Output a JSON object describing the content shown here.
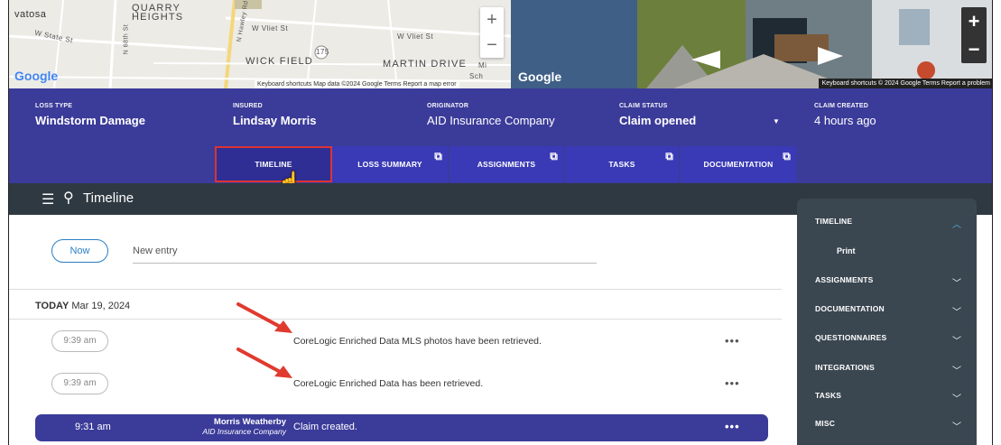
{
  "map": {
    "labels": [
      "vatosa",
      "QUARRY",
      "HEIGHTS",
      "W State St",
      "W Vliet St",
      "W Vliet St",
      "WICK FIELD",
      "175",
      "MARTIN DRIVE",
      "Sch",
      "Mi",
      "N 68th St",
      "N Hawley Rd"
    ],
    "google_label": "Google",
    "footer": "Keyboard shortcuts   Map data ©2024 Google   Terms   Report a map error",
    "zoom_in": "+",
    "zoom_out": "−"
  },
  "streetview": {
    "google_label": "Google",
    "footer": "Keyboard shortcuts   © 2024 Google   Terms   Report a problem",
    "zoom_in": "+",
    "zoom_out": "−"
  },
  "claim": {
    "loss_type_label": "LOSS TYPE",
    "loss_type": "Windstorm Damage",
    "insured_label": "INSURED",
    "insured": "Lindsay Morris",
    "originator_label": "ORIGINATOR",
    "originator": "AID Insurance Company",
    "status_label": "CLAIM STATUS",
    "status": "Claim opened",
    "created_label": "CLAIM CREATED",
    "created": "4 hours ago"
  },
  "tabs": [
    {
      "label": "TIMELINE"
    },
    {
      "label": "LOSS SUMMARY"
    },
    {
      "label": "ASSIGNMENTS"
    },
    {
      "label": "TASKS"
    },
    {
      "label": "DOCUMENTATION"
    }
  ],
  "strip": {
    "title": "Timeline"
  },
  "timeline": {
    "now_button": "Now",
    "new_entry_placeholder": "New entry",
    "today_label": "TODAY",
    "today_date": "Mar 19, 2024",
    "entries": [
      {
        "time": "9:39 am",
        "text": "CoreLogic Enriched Data MLS photos have been retrieved.",
        "menu": "•••"
      },
      {
        "time": "9:39 am",
        "text": "CoreLogic Enriched Data has been retrieved.",
        "menu": "•••"
      }
    ],
    "created": {
      "time": "9:31 am",
      "author": "Morris Weatherby",
      "company": "AID Insurance Company",
      "text": "Claim created.",
      "menu": "•••"
    }
  },
  "panel": {
    "items": [
      {
        "label": "TIMELINE"
      },
      {
        "label": "Print"
      },
      {
        "label": "ASSIGNMENTS"
      },
      {
        "label": "DOCUMENTATION"
      },
      {
        "label": "QUESTIONNAIRES"
      },
      {
        "label": "INTEGRATIONS"
      },
      {
        "label": "TASKS"
      },
      {
        "label": "MISC"
      }
    ]
  },
  "colors": {
    "primary": "#3b3b9a",
    "tab": "#3a3ab6",
    "highlight": "#d33333",
    "panel": "#3a4650",
    "strip": "#2f3941",
    "accent_blue": "#2a7fc5"
  }
}
